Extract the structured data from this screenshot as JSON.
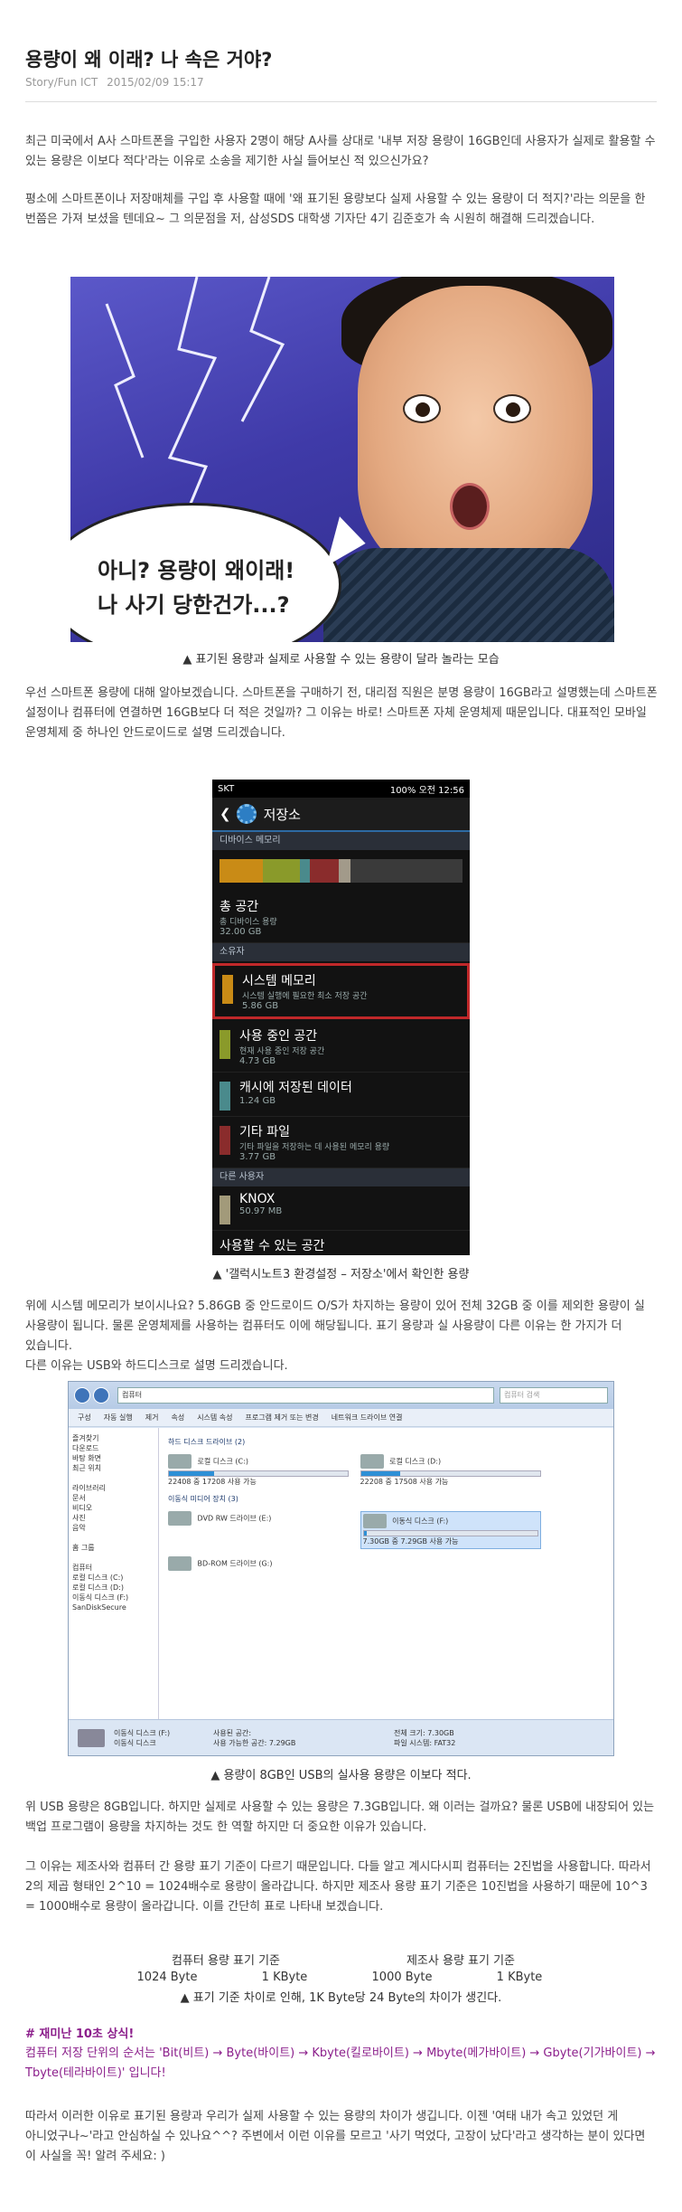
{
  "header": {
    "title": "용량이 왜 이래? 나 속은 거야?",
    "category": "Story/Fun ICT",
    "date": "2015/02/09 15:17"
  },
  "paragraphs": {
    "p1": "최근 미국에서 A사 스마트폰을 구입한 사용자 2명이 해당 A사를 상대로 '내부 저장 용량이 16GB인데 사용자가 실제로 활용할 수 있는 용량은 이보다 적다'라는 이유로 소송을 제기한 사실 들어보신 적 있으신가요?",
    "p2": "평소에 스마트폰이나 저장매체를 구입 후 사용할 때에 '왜 표기된 용량보다 실제 사용할 수 있는 용량이 더 적지?'라는 의문을 한 번쯤은 가져 보셨을 텐데요~ 그 의문점을 저, 삼성SDS 대학생 기자단 4기 김준호가 속 시원히 해결해 드리겠습니다.",
    "p3": "우선 스마트폰 용량에 대해 알아보겠습니다. 스마트폰을 구매하기 전, 대리점 직원은 분명 용량이 16GB라고 설명했는데 스마트폰 설정이나 컴퓨터에 연결하면 16GB보다 더 적은 것일까? 그 이유는 바로! 스마트폰 자체 운영체제 때문입니다. 대표적인 모바일 운영체제 중 하나인 안드로이드로 설명 드리겠습니다.",
    "p4": "위에 시스템 메모리가 보이시나요? 5.86GB 중 안드로이드 O/S가 차지하는 용량이 있어 전체 32GB 중 이를 제외한 용량이 실 사용량이 됩니다. 물론 운영체제를 사용하는 컴퓨터도 이에 해당됩니다. 표기 용량과 실 사용량이 다른 이유는 한 가지가 더 있습니다.",
    "p5": "다른 이유는 USB와 하드디스크로 설명 드리겠습니다.",
    "p6": "위 USB 용량은 8GB입니다. 하지만 실제로 사용할 수 있는 용량은 7.3GB입니다. 왜 이러는 걸까요? 물론 USB에 내장되어 있는 백업 프로그램이 용량을 차지하는 것도 한 역할 하지만 더 중요한 이유가 있습니다.",
    "p7": "그 이유는 제조사와 컴퓨터 간 용량 표기 기준이 다르기 때문입니다. 다들 알고 계시다시피 컴퓨터는 2진법을 사용합니다. 따라서 2의 제곱 형태인 2^10 = 1024배수로 용량이 올라갑니다. 하지만 제조사 용량 표기 기준은 10진법을 사용하기 때문에 10^3 = 1000배수로 용량이 올라갑니다. 이를 간단히 표로 나타내 보겠습니다.",
    "p8": "따라서 이러한 이유로 표기된 용량과 우리가 실제 사용할 수 있는 용량의 차이가 생깁니다. 이젠 '여태 내가 속고 있었던 게 아니었구나~'라고 안심하실 수 있나요^^? 주변에서 이런 이유를 모르고 '사기 먹었다, 고장이 났다'라고 생각하는 분이 있다면 이 사실을 꼭! 알려 주세요: )"
  },
  "captions": {
    "c1": "▲ 표기된 용량과 실제로 사용할 수 있는 용량이 달라 놀라는 모습",
    "c2": "▲ '갤럭시노트3 환경설정 – 저장소'에서 확인한 용량",
    "c3": "▲ 용량이 8GB인 USB의 실사용 용량은 이보다 적다.",
    "c4": "▲ 표기 기준 차이로 인해, 1K Byte당 24 Byte의 차이가 생긴다."
  },
  "image1": {
    "bubble_line1": "아니? 용량이 왜이래!",
    "bubble_line2": "나 사기 당한건가...?"
  },
  "phone": {
    "status_left": "SKT",
    "status_right": "100% 오전 12:56",
    "title": "저장소",
    "section_device": "디바이스 메모리",
    "bar_colors": [
      "#c98b16",
      "#8a9a2a",
      "#4a8a8c",
      "#8a2c2c",
      "#a29a8a",
      "#3a3a3a"
    ],
    "bar_fractions": [
      0.18,
      0.15,
      0.04,
      0.12,
      0.05,
      0.46
    ],
    "total_label": "총 공간",
    "total_sub": "총 디바이스 용량",
    "total_value": "32.00 GB",
    "section_owner": "소유자",
    "items": [
      {
        "name": "시스템 메모리",
        "desc": "시스템 실행에 필요한 최소 저장 공간",
        "size": "5.86 GB",
        "color": "#c98b16"
      },
      {
        "name": "사용 중인 공간",
        "desc": "현재 사용 중인 저장 공간",
        "size": "4.73 GB",
        "color": "#8a9a2a"
      },
      {
        "name": "캐시에 저장된 데이터",
        "desc": "",
        "size": "1.24 GB",
        "color": "#4a8a8c"
      },
      {
        "name": "기타 파일",
        "desc": "기타 파일을 저장하는 데 사용된 메모리 용량",
        "size": "3.77 GB",
        "color": "#8a2c2c"
      }
    ],
    "section_other": "다른 사용자",
    "knox_name": "KNOX",
    "knox_size": "50.97 MB",
    "cut_item": "사용할 수 있는 공간"
  },
  "explorer": {
    "address": "컴퓨터",
    "search_placeholder": "컴퓨터 검색",
    "menu": [
      "구성",
      "자동 실행",
      "제거",
      "속성",
      "시스템 속성",
      "프로그램 제거 또는 변경",
      "네트워크 드라이브 연결"
    ],
    "nav": [
      "즐겨찾기",
      "다운로드",
      "바탕 화면",
      "최근 위치",
      "라이브러리",
      "문서",
      "비디오",
      "사진",
      "음악",
      "홈 그룹",
      "컴퓨터",
      "로컬 디스크 (C:)",
      "로컬 디스크 (D:)",
      "이동식 디스크 (F:)",
      "SanDiskSecure"
    ],
    "group_hdd": "하드 디스크 드라이브 (2)",
    "drive_c": "로컬 디스크 (C:)",
    "drive_c_info": "22408 중 17208 사용 가능",
    "drive_c_used": 0.25,
    "drive_d": "로컬 디스크 (D:)",
    "drive_d_info": "22208 중 17508 사용 가능",
    "drive_d_used": 0.22,
    "group_removable": "이동식 미디어 장치 (3)",
    "dvd": "DVD RW 드라이브 (E:)",
    "usb": "이동식 디스크 (F:)",
    "usb_info": "7.30GB 중 7.29GB 사용 가능",
    "usb_used": 0.02,
    "bd": "BD-ROM 드라이브 (G:)",
    "foot_name": "이동식 디스크 (F:)",
    "foot_type": "이동식 디스크",
    "foot_used": "사용된 공간:",
    "foot_free": "사용 가능한 공간: 7.29GB",
    "foot_total": "전체 크기: 7.30GB",
    "foot_fs": "파일 시스템: FAT32"
  },
  "table": {
    "head_left": "컴퓨터 용량 표기 기준",
    "head_right": "제조사 용량 표기 기준",
    "cells": [
      "1024 Byte",
      "1 KByte",
      "1000 Byte",
      "1 KByte"
    ]
  },
  "tip": {
    "heading": "# 재미난 10초 상식!",
    "text": "컴퓨터 저장 단위의 순서는 'Bit(비트) → Byte(바이트) → Kbyte(킬로바이트) → Mbyte(메가바이트) → Gbyte(기가바이트) → Tbyte(테라바이트)' 입니다!"
  }
}
